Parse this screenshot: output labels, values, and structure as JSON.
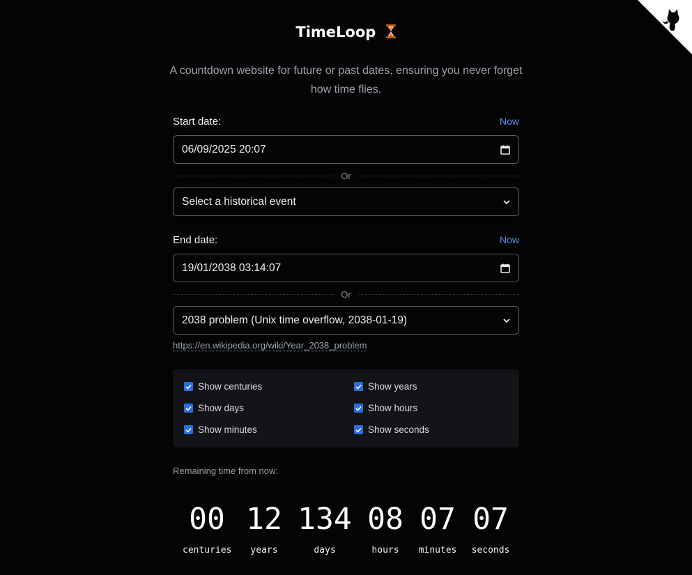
{
  "header": {
    "title": "TimeLoop",
    "subtitle": "A countdown website for future or past dates, ensuring you never forget how time flies."
  },
  "start": {
    "label": "Start date:",
    "now_label": "Now",
    "datetime_value": "06/09/2025 20:07",
    "or_label": "Or",
    "event_select_value": "Select a historical event"
  },
  "end": {
    "label": "End date:",
    "now_label": "Now",
    "datetime_value": "19/01/2038 03:14:07",
    "or_label": "Or",
    "event_select_value": "2038 problem (Unix time overflow, 2038-01-19)",
    "event_link": "https://en.wikipedia.org/wiki/Year_2038_problem"
  },
  "options": [
    {
      "label": "Show centuries",
      "checked": true
    },
    {
      "label": "Show years",
      "checked": true
    },
    {
      "label": "Show days",
      "checked": true
    },
    {
      "label": "Show hours",
      "checked": true
    },
    {
      "label": "Show minutes",
      "checked": true
    },
    {
      "label": "Show seconds",
      "checked": true
    }
  ],
  "countdown": {
    "caption": "Remaining time from now:",
    "units": [
      {
        "value": "00",
        "label": "centuries"
      },
      {
        "value": "12",
        "label": "years"
      },
      {
        "value": "134",
        "label": "days"
      },
      {
        "value": "08",
        "label": "hours"
      },
      {
        "value": "07",
        "label": "minutes"
      },
      {
        "value": "07",
        "label": "seconds"
      }
    ]
  },
  "icons": {
    "corner": "github-octocat-icon",
    "title": "hourglass-icon",
    "date_picker": "calendar-icon",
    "select": "chevron-down-icon",
    "checkbox": "checkmark-icon"
  },
  "colors": {
    "background": "#040405",
    "link": "#5a8fe6",
    "checkbox": "#2c6ee0",
    "panel": "#131417"
  }
}
